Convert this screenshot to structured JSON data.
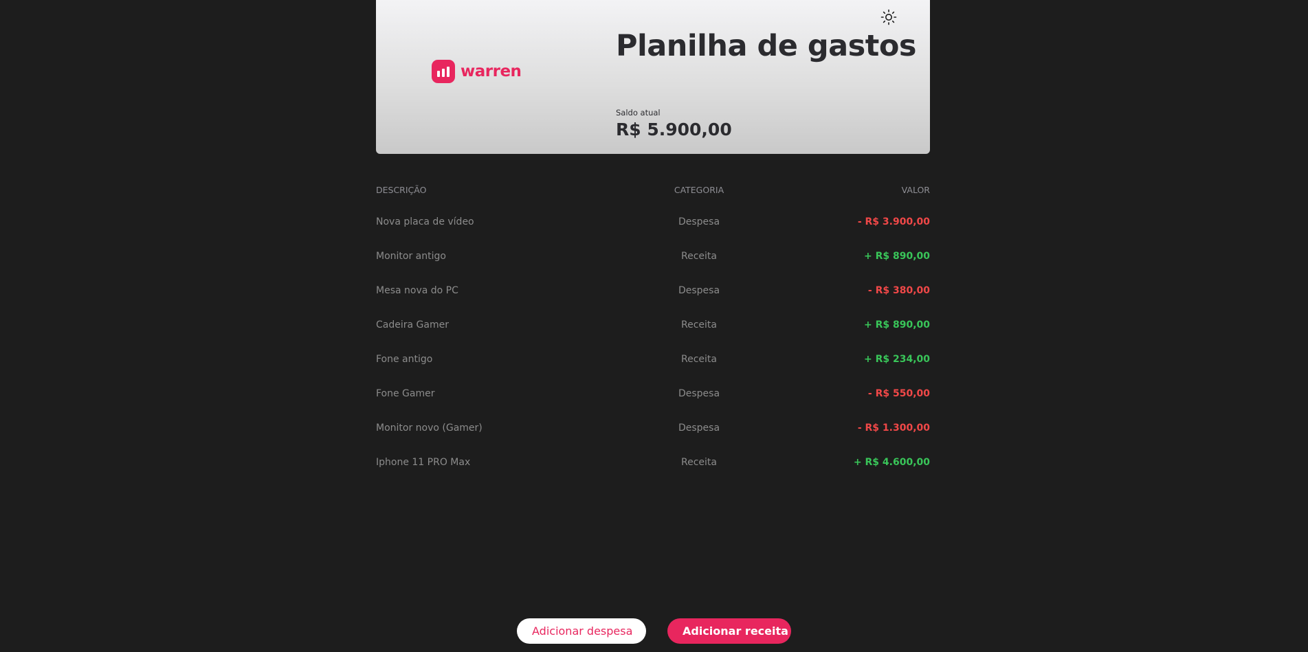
{
  "header": {
    "logo_text": "warren",
    "title": "Planilha de gastos",
    "balance_label": "Saldo atual",
    "balance_value": "R$ 5.900,00",
    "theme_icon": "sun-icon"
  },
  "table": {
    "columns": {
      "description": "DESCRIÇÃO",
      "category": "CATEGORIA",
      "value": "VALOR"
    },
    "rows": [
      {
        "description": "Nova placa de vídeo",
        "category": "Despesa",
        "value": "- R$ 3.900,00"
      },
      {
        "description": "Monitor antigo",
        "category": "Receita",
        "value": "+ R$ 890,00"
      },
      {
        "description": "Mesa nova do PC",
        "category": "Despesa",
        "value": "- R$ 380,00"
      },
      {
        "description": "Cadeira Gamer",
        "category": "Receita",
        "value": "+ R$ 890,00"
      },
      {
        "description": "Fone antigo",
        "category": "Receita",
        "value": "+ R$ 234,00"
      },
      {
        "description": "Fone Gamer",
        "category": "Despesa",
        "value": "- R$ 550,00"
      },
      {
        "description": "Monitor novo (Gamer)",
        "category": "Despesa",
        "value": "- R$ 1.300,00"
      },
      {
        "description": "Iphone 11 PRO Max",
        "category": "Receita",
        "value": "+ R$ 4.600,00"
      }
    ]
  },
  "actions": {
    "add_expense": "Adicionar despesa",
    "add_income": "Adicionar receita"
  },
  "colors": {
    "background": "#1d1d1d",
    "brand": "#e8265e",
    "expense": "#f04848",
    "income": "#39c559"
  }
}
